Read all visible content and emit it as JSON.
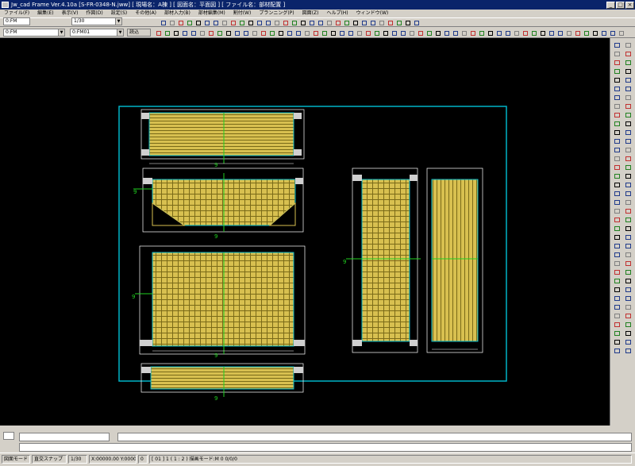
{
  "window": {
    "title": "Jw_cad Frame Ver.4.10a [S-FR-0348-N.jww] [ 現場名：A棟 ] [ 図面名：平面図 ] [ ファイル名：部材配置 ]",
    "controls": {
      "minimize": "_",
      "maximize": "□",
      "close": "×"
    }
  },
  "menu": [
    "ファイル(F)",
    "編集(E)",
    "表示(V)",
    "作図(D)",
    "設定(S)",
    "その他(A)",
    "部材入力(B)",
    "部材編集(M)",
    "割付(W)",
    "プランニング(P)",
    "図面(Z)",
    "ヘルプ(H)",
    "ウィンドウ(W)"
  ],
  "toolbar": {
    "layer_combo": "0:FM",
    "linetype_combo": "0:FM01",
    "scale_combo": "1/30",
    "pen_combo": "0:FM",
    "layer_button": "読込"
  },
  "colors": {
    "frame": "#00b4c8",
    "panel_fill": "#d8c050",
    "panel_line": "#8a7a20",
    "mark": "#20d020",
    "dim": "#ffffff",
    "canvas": "#000000"
  },
  "drawing": {
    "marks": [
      "9",
      "9",
      "9",
      "9",
      "9",
      "9",
      "9"
    ]
  },
  "status": {
    "mode": "図面モード",
    "snap": "直交スナップ",
    "scale": "1/30",
    "coords": "X:00000.00 Y:00000.00",
    "layer": "0",
    "message": "[ 01 ] 1 ( 1 : 2 ) 描画モード:M 0 0/0/0"
  }
}
